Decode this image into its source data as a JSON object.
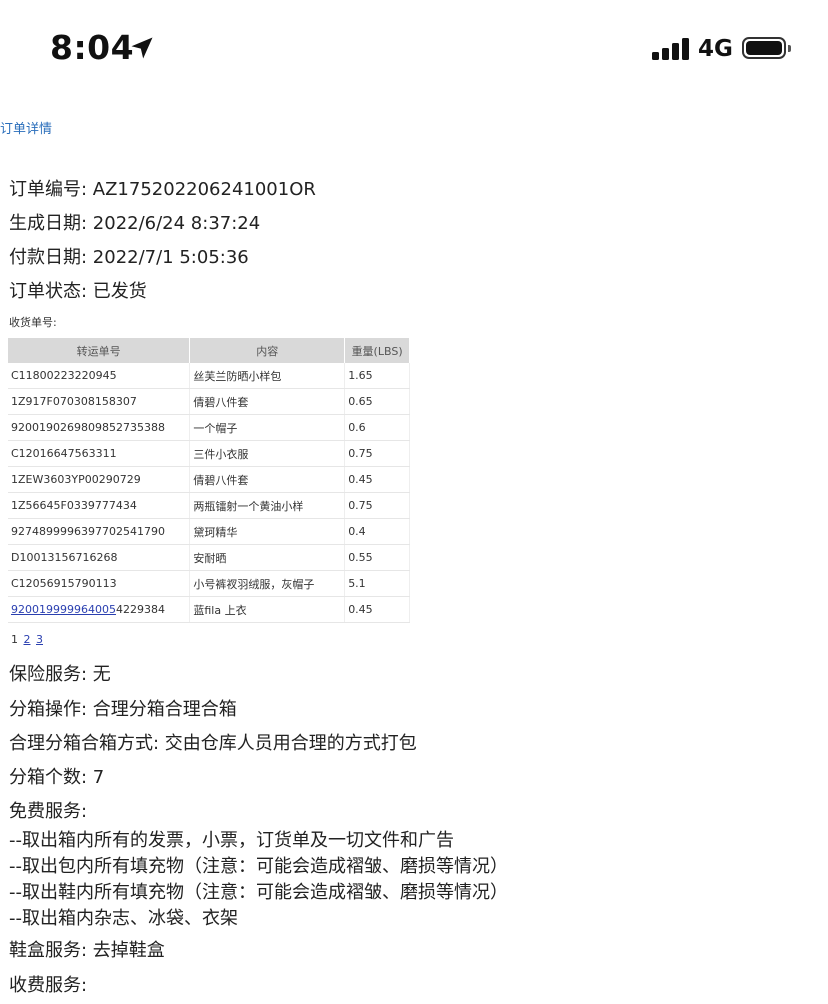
{
  "status_bar": {
    "time": "8:04",
    "network": "4G",
    "icons": [
      "location-arrow-icon",
      "signal-bars-icon",
      "battery-icon"
    ]
  },
  "page": {
    "breadcrumb": "订单详情"
  },
  "order": {
    "number_label": "订单编号: AZ175202206241001OR",
    "created_label": "生成日期: 2022/6/24 8:37:24",
    "paid_label": "付款日期: 2022/7/1 5:05:36",
    "status_label": "订单状态: 已发货",
    "receipt_label": "收货单号:"
  },
  "table": {
    "headers": [
      "转运单号",
      "内容",
      "重量(LBS)"
    ],
    "rows": [
      {
        "tracking": "C11800223220945",
        "content": "丝芙兰防晒小样包",
        "weight": "1.65"
      },
      {
        "tracking": "1Z917F070308158307",
        "content": "倩碧八件套",
        "weight": "0.65"
      },
      {
        "tracking": "9200190269809852735388",
        "content": "一个帽子",
        "weight": "0.6"
      },
      {
        "tracking": "C12016647563311",
        "content": "三件小衣服",
        "weight": "0.75"
      },
      {
        "tracking": "1ZEW3603YP00290729",
        "content": "倩碧八件套",
        "weight": "0.45"
      },
      {
        "tracking": "1Z56645F0339777434",
        "content": "两瓶镭射一个黄油小样",
        "weight": "0.75"
      },
      {
        "tracking": "9274899996397702541790",
        "content": "黛珂精华",
        "weight": "0.4"
      },
      {
        "tracking": "D10013156716268",
        "content": "安耐晒",
        "weight": "0.55"
      },
      {
        "tracking": "C12056915790113",
        "content": "小号裤衩羽绒服，灰帽子",
        "weight": "5.1"
      },
      {
        "tracking_link": "920019999964005",
        "tracking_rest": "4229384",
        "content": "蓝fila 上衣",
        "weight": "0.45"
      }
    ]
  },
  "pagination": {
    "current": "1",
    "pages": [
      "2",
      "3"
    ]
  },
  "services": {
    "insurance": "保险服务: 无",
    "split_op": "分箱操作: 合理分箱合理合箱",
    "split_method": "合理分箱合箱方式: 交由仓库人员用合理的方式打包",
    "box_count": "分箱个数: 7",
    "free_title": "免费服务:",
    "free_items": [
      "--取出箱内所有的发票，小票，订货单及一切文件和广告",
      "--取出包内所有填充物（注意：可能会造成褶皱、磨损等情况）",
      "--取出鞋内所有填充物（注意：可能会造成褶皱、磨损等情况）",
      "--取出箱内杂志、冰袋、衣架"
    ],
    "shoebox": "鞋盒服务: 去掉鞋盒",
    "paid_title": "收费服务:"
  }
}
